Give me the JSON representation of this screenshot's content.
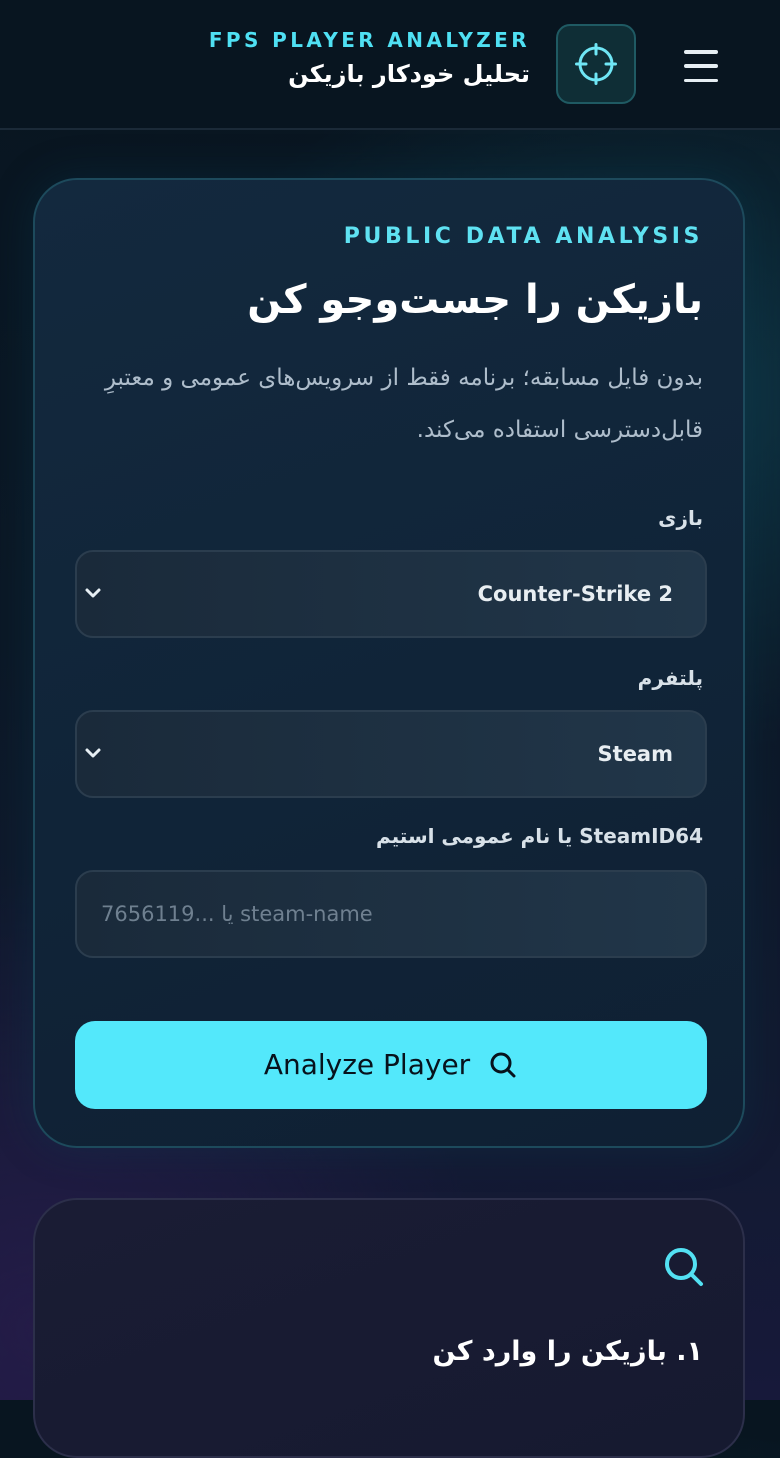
{
  "header": {
    "brand_subtitle": "FPS PLAYER ANALYZER",
    "brand_title": "تحلیل خودکار بازیکن",
    "logo_icon": "crosshair-icon",
    "menu_icon": "hamburger-menu-icon"
  },
  "search": {
    "eyebrow": "PUBLIC DATA ANALYSIS",
    "title": "بازیکن را جست‌وجو کن",
    "description": "بدون فایل مسابقه؛ برنامه فقط از سرویس‌های عمومی و معتبرِ قابل‌دسترسی استفاده می‌کند.",
    "game_label": "بازی",
    "game_value": "Counter-Strike 2",
    "platform_label": "پلتفرم",
    "platform_value": "Steam",
    "id_label": "SteamID64 یا نام عمومی استیم",
    "id_placeholder": "7656119... یا steam-name",
    "id_value": "",
    "analyze_label": "Analyze Player",
    "analyze_icon": "search-icon"
  },
  "steps": {
    "icon": "search-icon",
    "step1_title": "۱. بازیکن را وارد کن"
  },
  "colors": {
    "accent": "#53e8fb",
    "background": "#0b1826",
    "card": "#13293e"
  }
}
